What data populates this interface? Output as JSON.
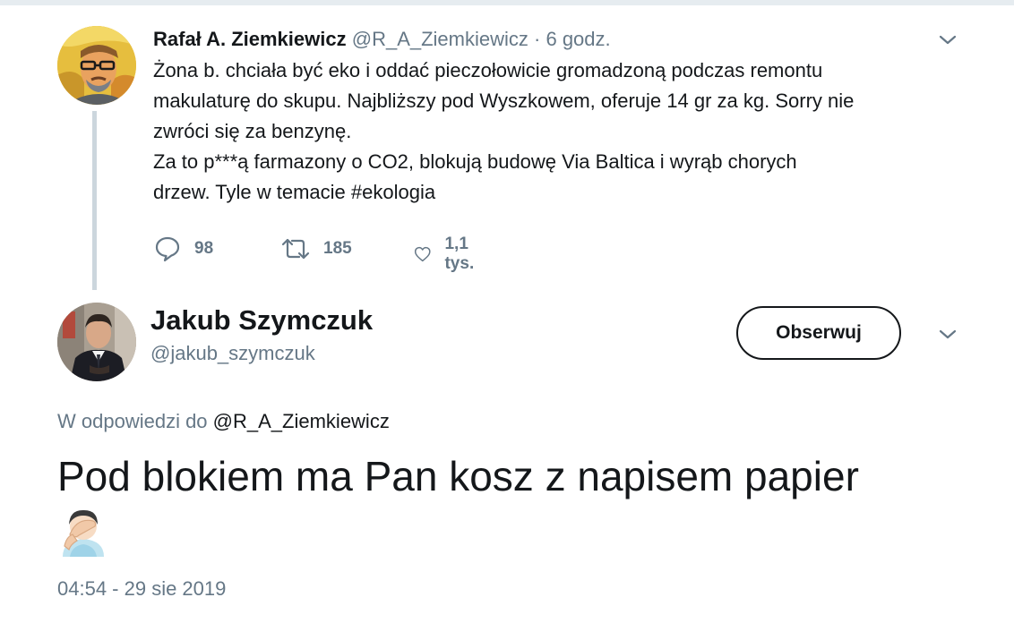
{
  "parent_tweet": {
    "author_name": "Rafał A. Ziemkiewicz",
    "handle": "@R_A_Ziemkiewicz",
    "separator": "·",
    "time": "6 godz.",
    "text_lines": [
      "Żona b. chciała być eko i oddać pieczołowicie gromadzoną podczas remontu",
      "makulaturę do skupu. Najbliższy pod Wyszkowem, oferuje 14 gr za kg. Sorry nie",
      "zwróci się za benzynę.",
      "Za to p***ą farmazony o CO2, blokują budowę Via Baltica i wyrąb chorych",
      "drzew. Tyle w temacie #ekologia"
    ],
    "reply_count": "98",
    "retweet_count": "185",
    "like_count": "1,1 tys."
  },
  "main_tweet": {
    "author_name": "Jakub Szymczuk",
    "handle": "@jakub_szymczuk",
    "follow_label": "Obserwuj",
    "reply_prefix": "W odpowiedzi do",
    "reply_target": "@R_A_Ziemkiewicz",
    "text": "Pod blokiem ma Pan kosz z napisem papier",
    "emoji": "facepalm-emoji",
    "timestamp": "04:54 - 29 sie 2019"
  },
  "colors": {
    "text_primary": "#14171a",
    "text_secondary": "#657786",
    "thread_line": "#ccd6dd",
    "top_border": "#e6ecf0"
  },
  "icons": {
    "reply": "reply-icon",
    "retweet": "retweet-icon",
    "like": "heart-icon",
    "menu": "chevron-down-icon"
  }
}
